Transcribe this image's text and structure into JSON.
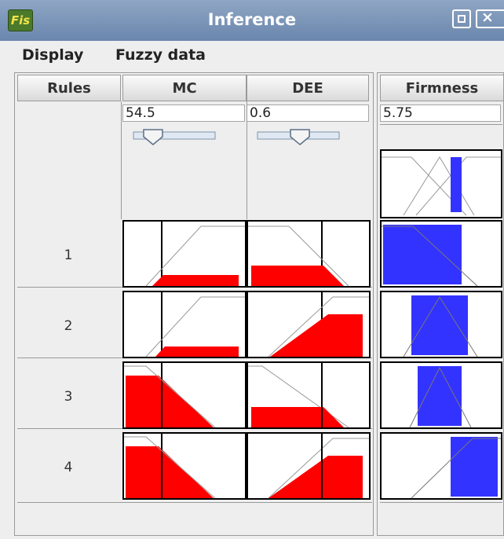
{
  "window": {
    "title": "Inference",
    "icon_text": "Fis"
  },
  "menu": {
    "items": [
      "Display",
      "Fuzzy data"
    ]
  },
  "columns": {
    "rules": "Rules",
    "inputs": [
      "MC",
      "DEE"
    ],
    "output": "Firmness"
  },
  "values": {
    "mc": "54.5",
    "dee": "0.6",
    "firmness": "5.75"
  },
  "sliders": {
    "mc_fraction": 0.24,
    "dee_fraction": 0.52
  },
  "rules": [
    "1",
    "2",
    "3",
    "4"
  ],
  "colors": {
    "input_activation": "#ff0000",
    "output_activation": "#3333ff",
    "titlebar": "#7c95b9"
  }
}
